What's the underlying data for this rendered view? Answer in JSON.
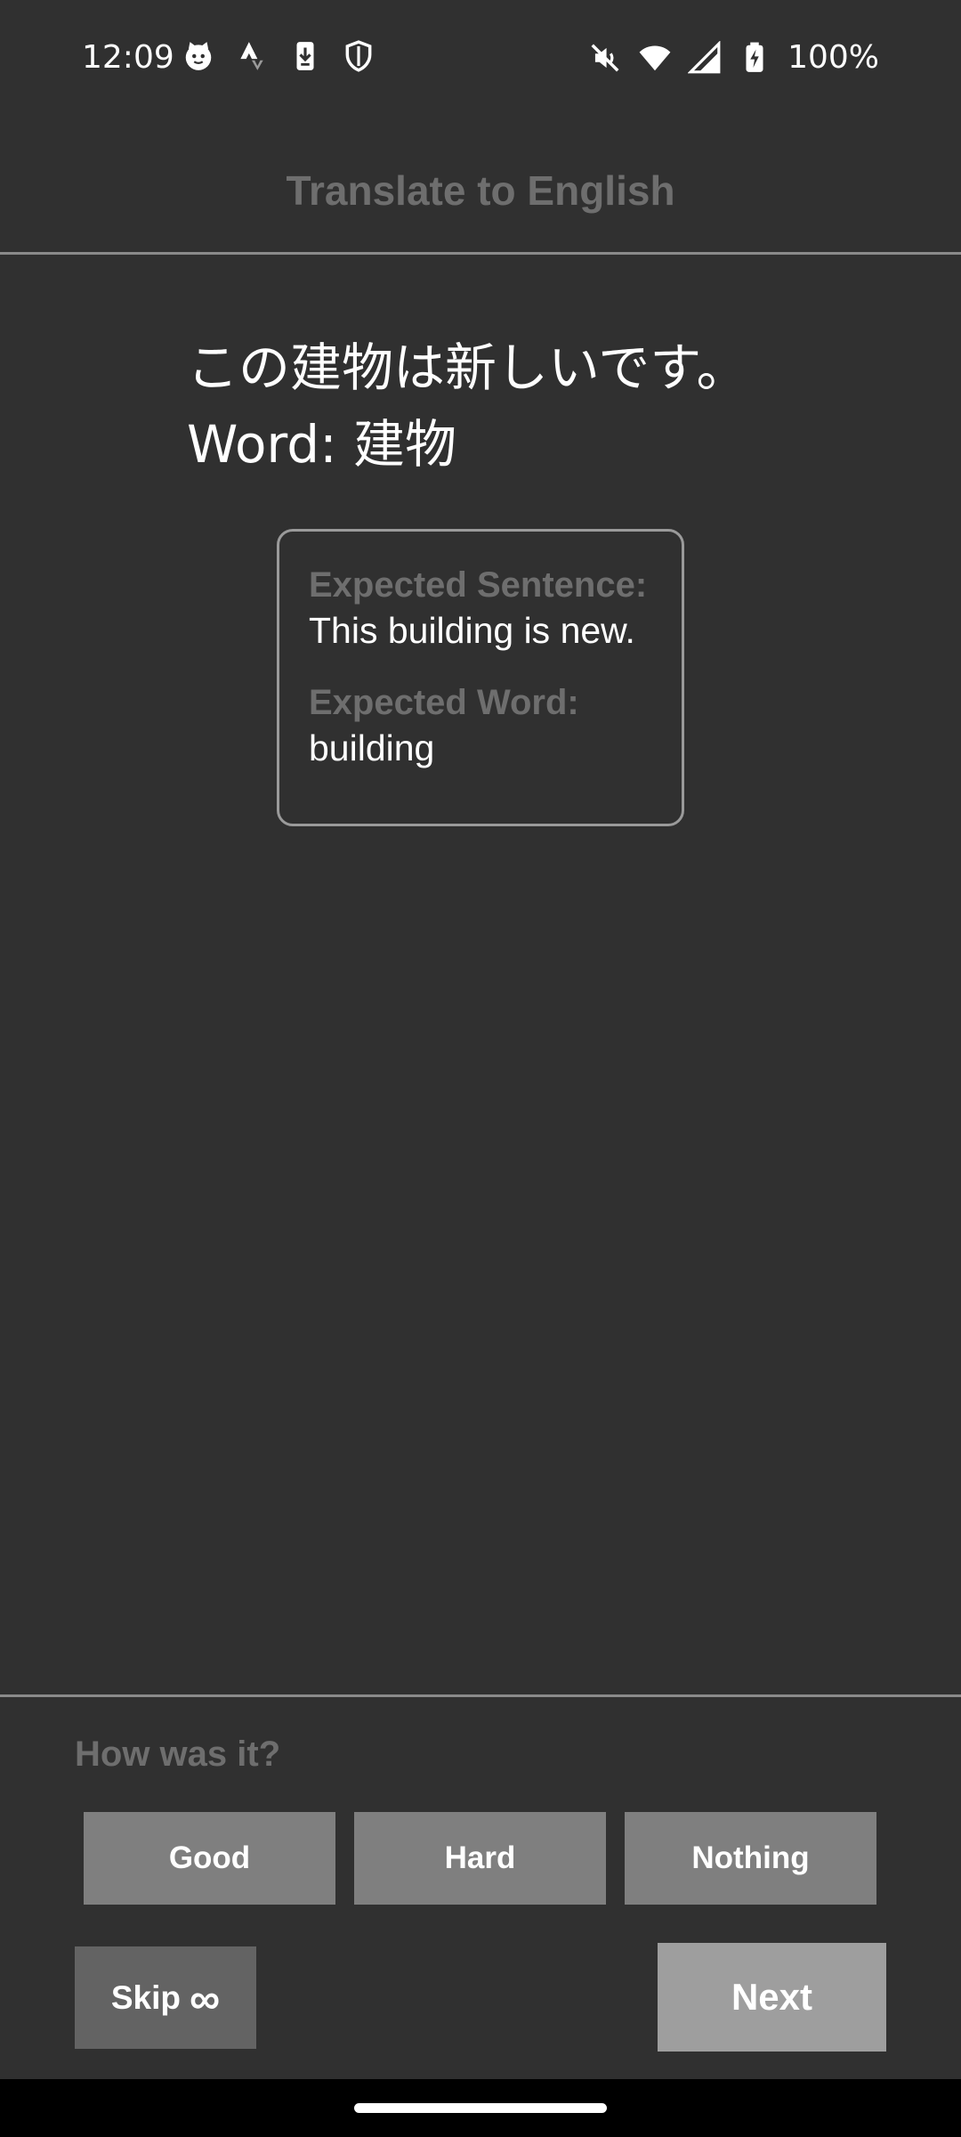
{
  "status_bar": {
    "time": "12:09",
    "battery": "100%",
    "left_icons": [
      "cat-face-icon",
      "strava-icon",
      "download-phone-icon",
      "shield-icon"
    ],
    "right_icons": [
      "vibrate-off-icon",
      "wifi-icon",
      "signal-icon",
      "battery-charging-icon"
    ]
  },
  "header": {
    "title": "Translate to English"
  },
  "prompt": {
    "sentence": "この建物は新しいです。",
    "word": "Word: 建物"
  },
  "answer": {
    "sentence_label": "Expected Sentence:",
    "sentence_value": "This building is new.",
    "word_label": "Expected Word:",
    "word_value": "building"
  },
  "rating": {
    "question": "How was it?",
    "good_label": "Good",
    "hard_label": "Hard",
    "nothing_label": "Nothing"
  },
  "actions": {
    "skip_label": "Skip",
    "skip_symbol": "∞",
    "next_label": "Next"
  },
  "colors": {
    "background": "#303030",
    "muted_text": "#6e6e6e",
    "rating_button": "#7f7f7f",
    "skip_button": "#636363",
    "next_button": "#9e9e9e",
    "divider": "#8a8a8a"
  }
}
